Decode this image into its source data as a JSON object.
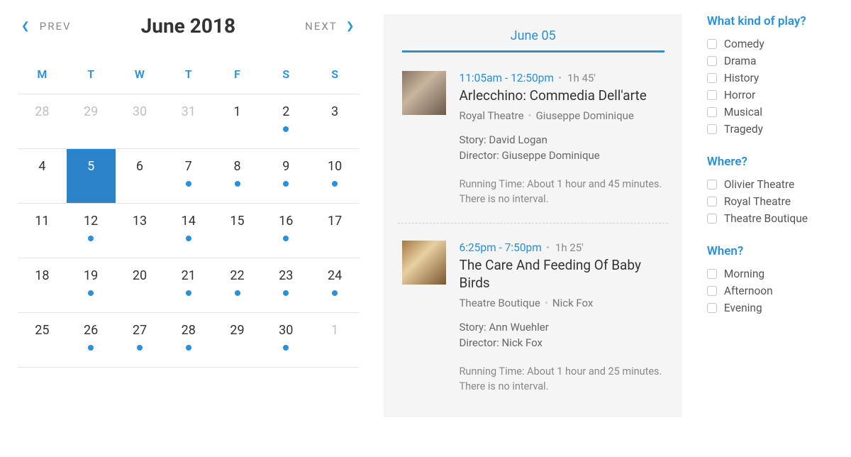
{
  "calendar": {
    "prev_label": "PREV",
    "next_label": "NEXT",
    "title": "June 2018",
    "weekdays": [
      "M",
      "T",
      "W",
      "T",
      "F",
      "S",
      "S"
    ],
    "weeks": [
      [
        {
          "n": 28,
          "dim": true,
          "dot": false,
          "sel": false
        },
        {
          "n": 29,
          "dim": true,
          "dot": false,
          "sel": false
        },
        {
          "n": 30,
          "dim": true,
          "dot": false,
          "sel": false
        },
        {
          "n": 31,
          "dim": true,
          "dot": false,
          "sel": false
        },
        {
          "n": 1,
          "dim": false,
          "dot": false,
          "sel": false
        },
        {
          "n": 2,
          "dim": false,
          "dot": true,
          "sel": false
        },
        {
          "n": 3,
          "dim": false,
          "dot": false,
          "sel": false
        }
      ],
      [
        {
          "n": 4,
          "dim": false,
          "dot": false,
          "sel": false
        },
        {
          "n": 5,
          "dim": false,
          "dot": false,
          "sel": true
        },
        {
          "n": 6,
          "dim": false,
          "dot": false,
          "sel": false
        },
        {
          "n": 7,
          "dim": false,
          "dot": true,
          "sel": false
        },
        {
          "n": 8,
          "dim": false,
          "dot": true,
          "sel": false
        },
        {
          "n": 9,
          "dim": false,
          "dot": true,
          "sel": false
        },
        {
          "n": 10,
          "dim": false,
          "dot": true,
          "sel": false
        }
      ],
      [
        {
          "n": 11,
          "dim": false,
          "dot": false,
          "sel": false
        },
        {
          "n": 12,
          "dim": false,
          "dot": true,
          "sel": false
        },
        {
          "n": 13,
          "dim": false,
          "dot": false,
          "sel": false
        },
        {
          "n": 14,
          "dim": false,
          "dot": true,
          "sel": false
        },
        {
          "n": 15,
          "dim": false,
          "dot": false,
          "sel": false
        },
        {
          "n": 16,
          "dim": false,
          "dot": true,
          "sel": false
        },
        {
          "n": 17,
          "dim": false,
          "dot": false,
          "sel": false
        }
      ],
      [
        {
          "n": 18,
          "dim": false,
          "dot": false,
          "sel": false
        },
        {
          "n": 19,
          "dim": false,
          "dot": true,
          "sel": false
        },
        {
          "n": 20,
          "dim": false,
          "dot": false,
          "sel": false
        },
        {
          "n": 21,
          "dim": false,
          "dot": true,
          "sel": false
        },
        {
          "n": 22,
          "dim": false,
          "dot": true,
          "sel": false
        },
        {
          "n": 23,
          "dim": false,
          "dot": true,
          "sel": false
        },
        {
          "n": 24,
          "dim": false,
          "dot": true,
          "sel": false
        }
      ],
      [
        {
          "n": 25,
          "dim": false,
          "dot": false,
          "sel": false
        },
        {
          "n": 26,
          "dim": false,
          "dot": true,
          "sel": false
        },
        {
          "n": 27,
          "dim": false,
          "dot": true,
          "sel": false
        },
        {
          "n": 28,
          "dim": false,
          "dot": true,
          "sel": false
        },
        {
          "n": 29,
          "dim": false,
          "dot": false,
          "sel": false
        },
        {
          "n": 30,
          "dim": false,
          "dot": true,
          "sel": false
        },
        {
          "n": 1,
          "dim": true,
          "dot": false,
          "sel": false
        }
      ]
    ]
  },
  "events_panel": {
    "date_label": "June 05",
    "events": [
      {
        "time": "11:05am - 12:50pm",
        "duration": "1h 45'",
        "title": "Arlecchino: Commedia Dell'arte",
        "venue": "Royal Theatre",
        "artist": "Giuseppe Dominique",
        "story": "Story: David Logan",
        "director": "Director: Giuseppe Dominique",
        "running": "Running Time: About 1 hour and 45 minutes. There is no interval."
      },
      {
        "time": "6:25pm - 7:50pm",
        "duration": "1h 25'",
        "title": "The Care And Feeding Of Baby Birds",
        "venue": "Theatre Boutique",
        "artist": "Nick Fox",
        "story": "Story: Ann Wuehler",
        "director": "Director: Nick Fox",
        "running": "Running Time: About 1 hour and 25 minutes. There is no interval."
      }
    ]
  },
  "filters": {
    "kind": {
      "title": "What kind of play?",
      "options": [
        "Comedy",
        "Drama",
        "History",
        "Horror",
        "Musical",
        "Tragedy"
      ]
    },
    "where": {
      "title": "Where?",
      "options": [
        "Olivier Theatre",
        "Royal Theatre",
        "Theatre Boutique"
      ]
    },
    "when": {
      "title": "When?",
      "options": [
        "Morning",
        "Afternoon",
        "Evening"
      ]
    }
  }
}
